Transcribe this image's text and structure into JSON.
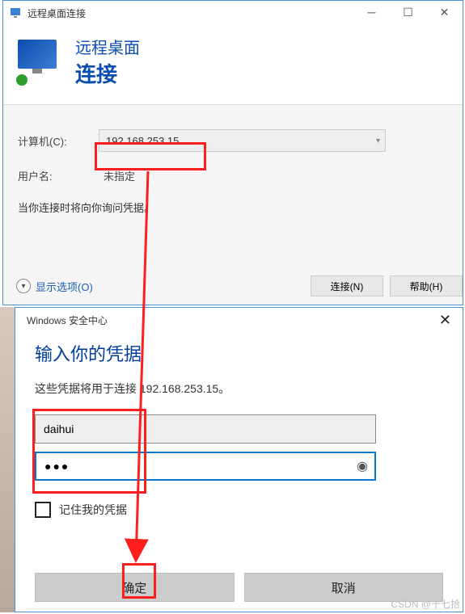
{
  "rdp": {
    "window_title": "远程桌面连接",
    "banner_line1": "远程桌面",
    "banner_line2": "连接",
    "computer_label": "计算机(C):",
    "computer_value": "192.168.253.15",
    "username_label": "用户名:",
    "username_value": "未指定",
    "hint": "当你连接时将向你询问凭据。",
    "show_options": "显示选项(O)",
    "connect_btn": "连接(N)",
    "help_btn": "帮助(H)"
  },
  "cred": {
    "title": "Windows 安全中心",
    "heading": "输入你的凭据",
    "subtext": "这些凭据将用于连接 192.168.253.15。",
    "username_value": "daihui",
    "password_value": "●●●",
    "remember_label": "记住我的凭据",
    "ok_btn": "确定",
    "cancel_btn": "取消"
  },
  "watermark": "CSDN @十七拾"
}
